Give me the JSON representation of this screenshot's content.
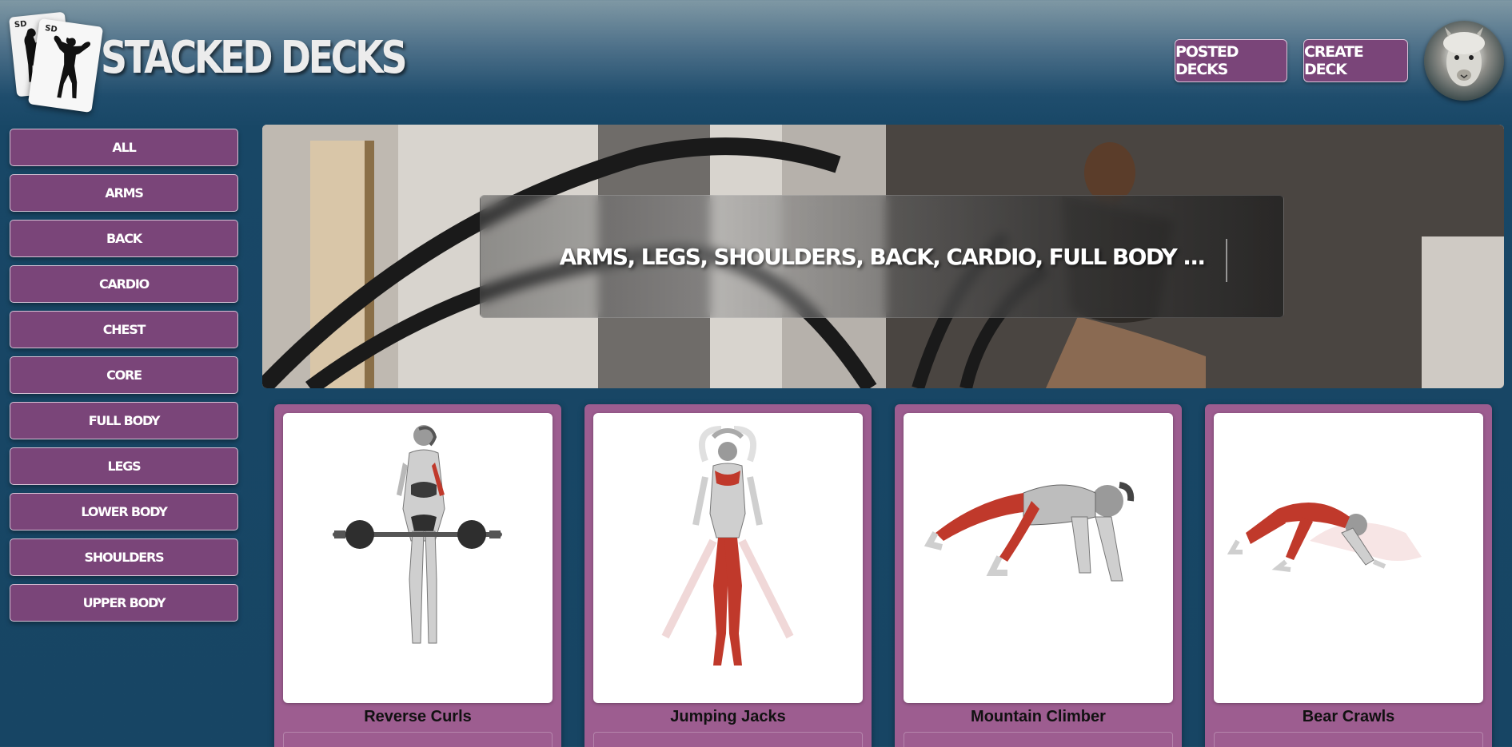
{
  "app": {
    "title": "STACKED DECKS",
    "logo_mark": "SD"
  },
  "header": {
    "posted_decks_label": "POSTED DECKS",
    "create_deck_label": "CREATE DECK",
    "avatar_icon": "user-avatar-icon"
  },
  "sidebar": {
    "items": [
      {
        "label": "ALL"
      },
      {
        "label": "ARMS"
      },
      {
        "label": "BACK"
      },
      {
        "label": "CARDIO"
      },
      {
        "label": "CHEST"
      },
      {
        "label": "CORE"
      },
      {
        "label": "FULL BODY"
      },
      {
        "label": "LEGS"
      },
      {
        "label": "LOWER BODY"
      },
      {
        "label": "SHOULDERS"
      },
      {
        "label": "UPPER BODY"
      }
    ]
  },
  "hero": {
    "text": "ARMS, LEGS, SHOULDERS, BACK, CARDIO, FULL BODY ..."
  },
  "exercises": [
    {
      "name": "Reverse Curls",
      "icon": "barbell-exercise-icon"
    },
    {
      "name": "Jumping Jacks",
      "icon": "jumping-jacks-icon"
    },
    {
      "name": "Mountain Climber",
      "icon": "mountain-climber-icon"
    },
    {
      "name": "Bear Crawls",
      "icon": "bear-crawl-icon"
    }
  ],
  "colors": {
    "accent": "#7a4579",
    "card": "#9d5d90",
    "background": "#174564",
    "muscle": "#c0392b"
  }
}
